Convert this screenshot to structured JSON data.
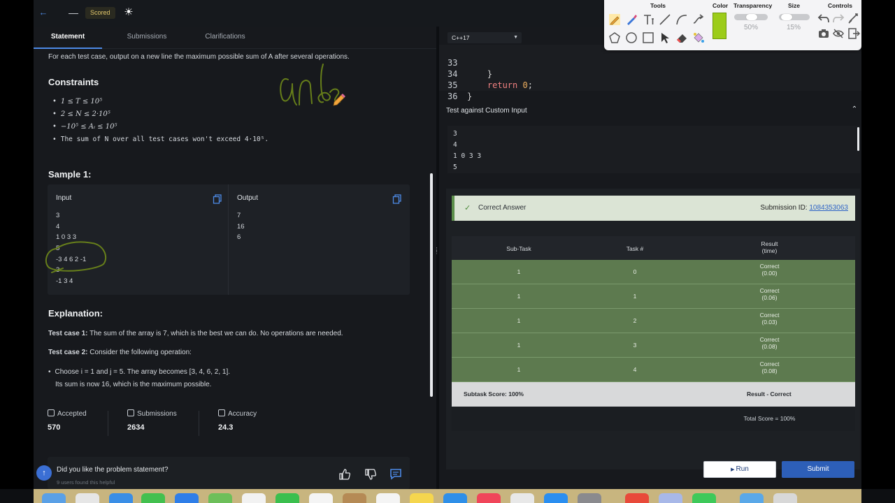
{
  "topbar": {
    "badge": "Scored"
  },
  "tabs": {
    "statement": "Statement",
    "submissions": "Submissions",
    "clarifications": "Clarifications"
  },
  "statement": {
    "output_line": "For each test case, output on a new line the maximum possible sum of A after several operations.",
    "constraints_title": "Constraints",
    "constraints": [
      "1 ≤ T ≤ 10⁵",
      "2 ≤ N ≤ 2·10⁵",
      "−10⁵ ≤ Aᵢ ≤ 10⁵",
      "The sum of N over all test cases won't exceed 4·10⁵."
    ],
    "sample_title": "Sample 1:",
    "input_label": "Input",
    "output_label": "Output",
    "input_lines": [
      "3",
      "4",
      "1 0 3 3",
      "5",
      "-3 4 6 2 -1",
      "3",
      "-1 3 4"
    ],
    "output_lines": [
      "7",
      "16",
      "6"
    ],
    "explanation_title": "Explanation:",
    "tc1_label": "Test case 1:",
    "tc1_text": "The sum of the array is 7, which is the best we can do. No operations are needed.",
    "tc2_label": "Test case 2:",
    "tc2_text": "Consider the following operation:",
    "tc2_bullet": "Choose i = 1 and j = 5. The array becomes [3, 4, 6, 2, 1].",
    "tc2_bullet2": "Its sum is now 16, which is the maximum possible."
  },
  "stats": {
    "accepted_label": "Accepted",
    "accepted_value": "570",
    "submissions_label": "Submissions",
    "submissions_value": "2634",
    "accuracy_label": "Accuracy",
    "accuracy_value": "24.3"
  },
  "feedback": {
    "question": "Did you like the problem statement?",
    "helpful": "9 users found this helpful"
  },
  "editor": {
    "language": "C++17",
    "lines": [
      {
        "n": "33",
        "code": "    }"
      },
      {
        "n": "34",
        "code": "    return 0;"
      },
      {
        "n": "35",
        "code": "}"
      },
      {
        "n": "36",
        "code": ""
      }
    ]
  },
  "custom_input": {
    "title": "Test against Custom Input",
    "lines": [
      "3",
      "4",
      "1 0 3 3",
      "5"
    ]
  },
  "result": {
    "status": "Correct Answer",
    "submission_label": "Submission ID:",
    "submission_id": "1084353063",
    "headers": {
      "subtask": "Sub-Task",
      "task": "Task #",
      "result": "Result",
      "time": "(time)"
    },
    "rows": [
      {
        "subtask": "1",
        "task": "0",
        "result": "Correct",
        "time": "(0.00)"
      },
      {
        "subtask": "1",
        "task": "1",
        "result": "Correct",
        "time": "(0.06)"
      },
      {
        "subtask": "1",
        "task": "2",
        "result": "Correct",
        "time": "(0.03)"
      },
      {
        "subtask": "1",
        "task": "3",
        "result": "Correct",
        "time": "(0.08)"
      },
      {
        "subtask": "1",
        "task": "4",
        "result": "Correct",
        "time": "(0.08)"
      }
    ],
    "subtask_score": "Subtask Score: 100%",
    "result_correct": "Result - Correct",
    "total_score": "Total Score = 100%"
  },
  "buttons": {
    "run": "Run",
    "submit": "Submit"
  },
  "annotation_toolbar": {
    "tools_title": "Tools",
    "color_title": "Color",
    "transparency_title": "Transparency",
    "size_title": "Size",
    "controls_title": "Controls",
    "transparency_value": "50%",
    "size_value": "15%",
    "color": "#9ccc1a"
  },
  "handwriting": "ans"
}
